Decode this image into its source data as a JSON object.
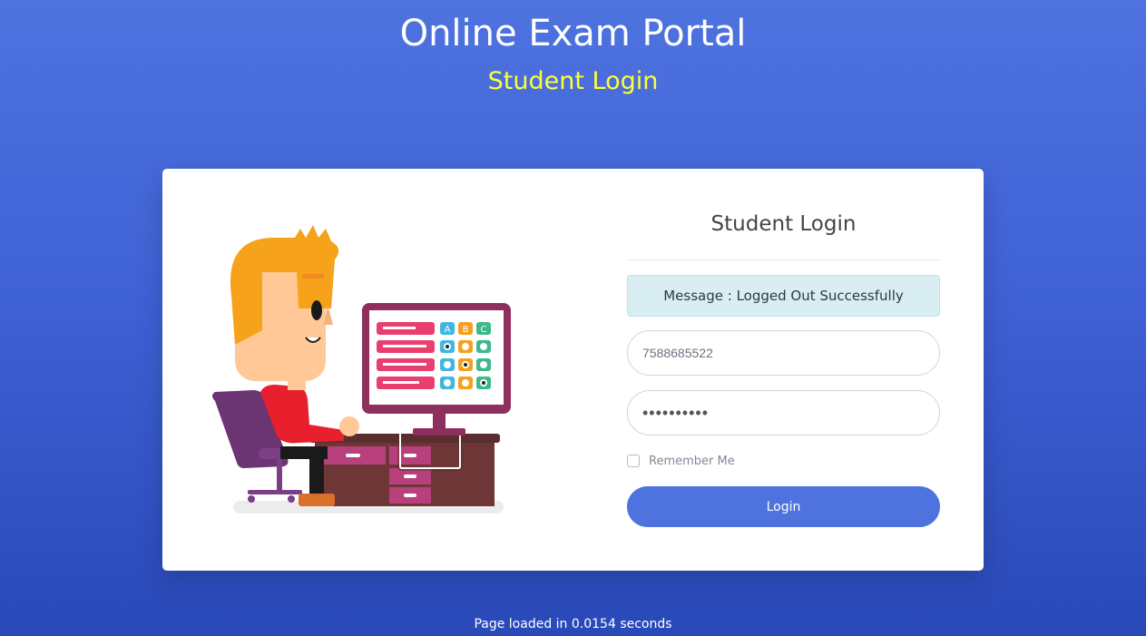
{
  "header": {
    "title": "Online Exam Portal",
    "subtitle": "Student Login"
  },
  "login_form": {
    "title": "Student Login",
    "message": "Message : Logged Out Successfully",
    "phone_value": "7588685522",
    "password_value": "••••••••••",
    "remember_label": "Remember Me",
    "login_label": "Login"
  },
  "illustration": {
    "answer_options": [
      "A",
      "B",
      "C"
    ]
  },
  "footer": {
    "text": "Page loaded in 0.0154 seconds"
  },
  "colors": {
    "primary": "#4e73df",
    "subtitle": "#ffff33",
    "alert_bg": "#d9eef3"
  }
}
